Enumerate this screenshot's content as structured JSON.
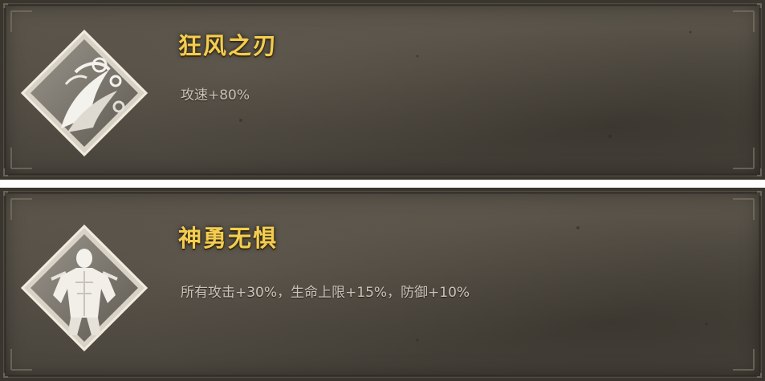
{
  "skills": [
    {
      "name": "狂风之刃",
      "description": "攻速+80%",
      "icon": "wind-blade-icon"
    },
    {
      "name": "神勇无惧",
      "description": "所有攻击+30%，生命上限+15%，防御+10%",
      "icon": "brave-warrior-icon"
    }
  ],
  "colors": {
    "title_gold": "#f3cd52",
    "description_text": "#c9c3b8",
    "card_background": "#4f4a41"
  }
}
